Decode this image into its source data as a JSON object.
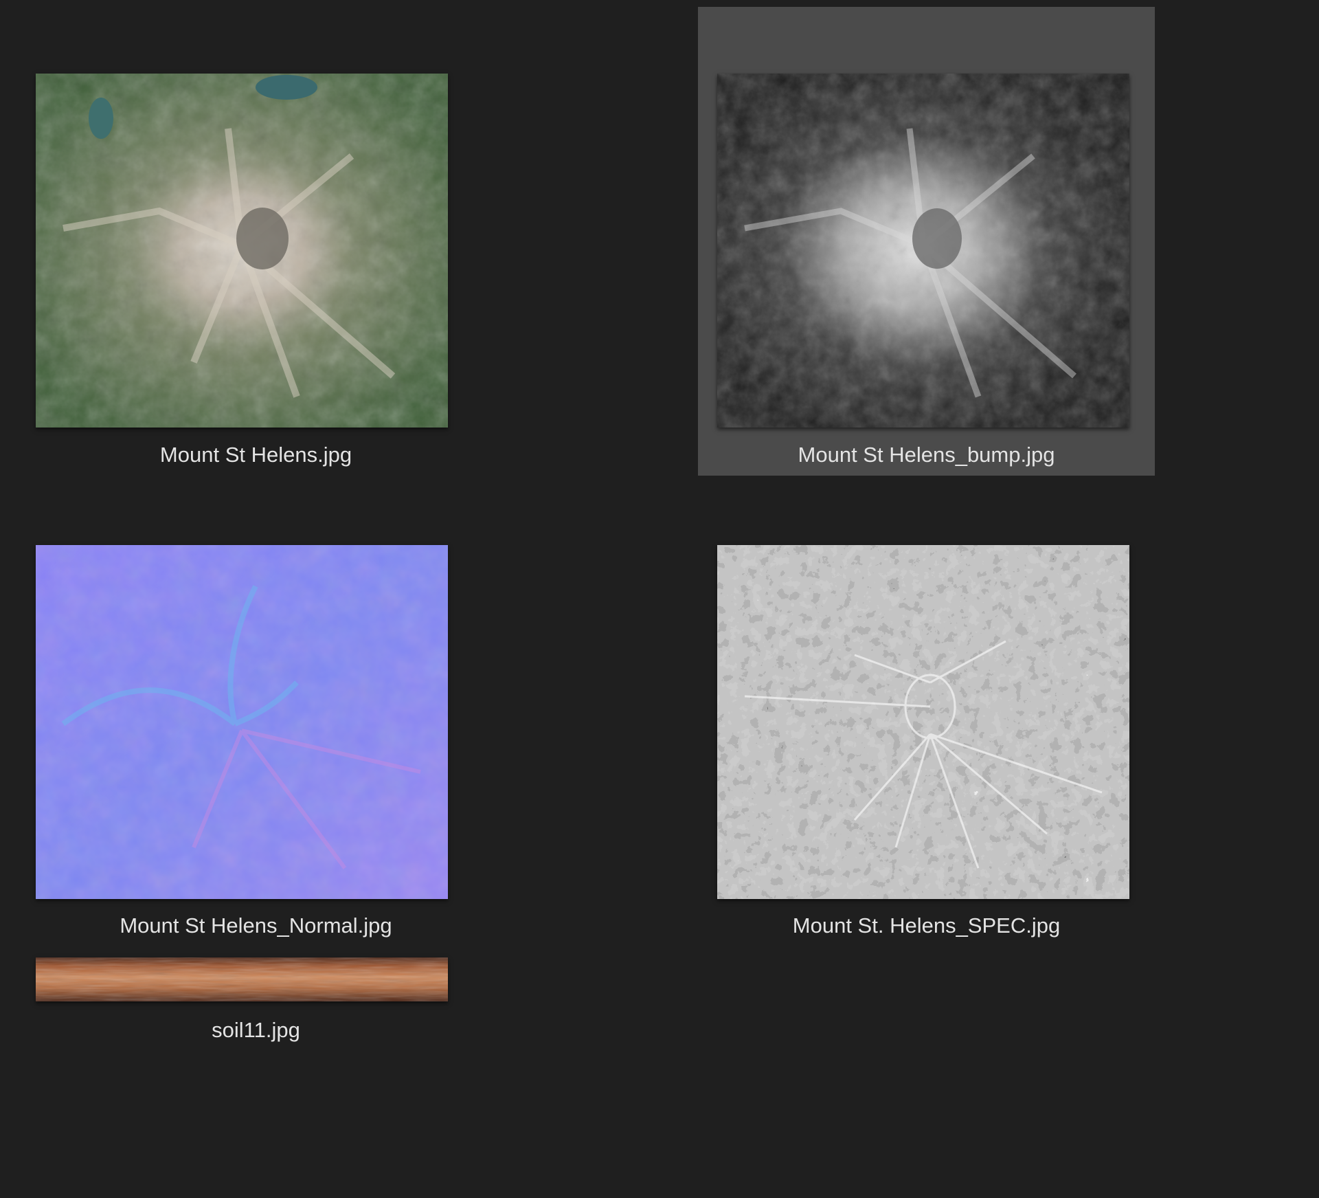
{
  "files": [
    {
      "name": "Mount St Helens.jpg",
      "icon": "satellite-color-thumbnail",
      "selected": false
    },
    {
      "name": "Mount St Helens_bump.jpg",
      "icon": "grayscale-bump-thumbnail",
      "selected": true
    },
    {
      "name": "Mount St Helens_Normal.jpg",
      "icon": "normal-map-thumbnail",
      "selected": false
    },
    {
      "name": "Mount St. Helens_SPEC.jpg",
      "icon": "specular-map-thumbnail",
      "selected": false
    },
    {
      "name": "soil11.jpg",
      "icon": "soil-texture-thumbnail",
      "selected": false
    }
  ],
  "colors": {
    "background": "#1f1f1f",
    "selection": "#4b4b4b",
    "caption_text": "#e4e4e4"
  }
}
